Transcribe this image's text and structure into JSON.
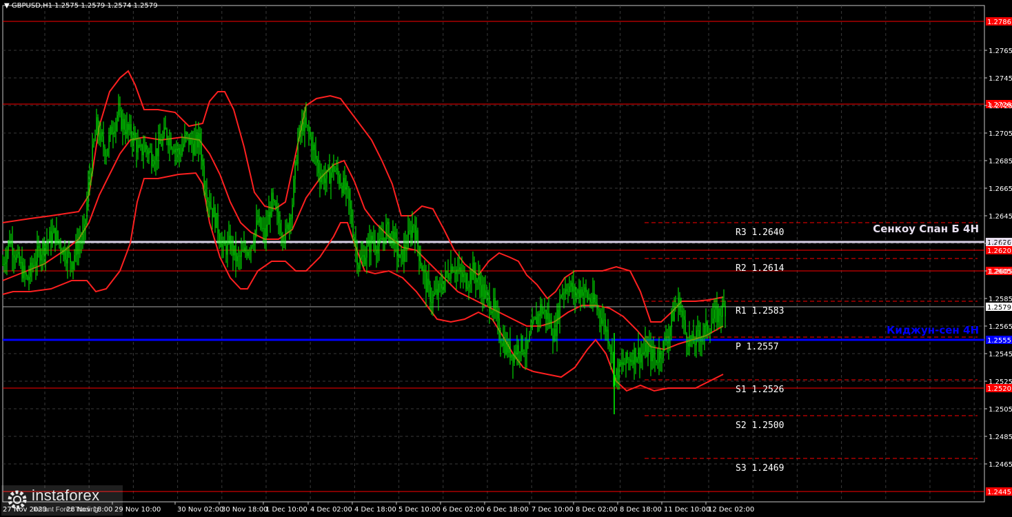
{
  "symbol_header": "GBPUSD,H1  1.2575 1.2579 1.2574 1.2579",
  "colors": {
    "background": "#000000",
    "grid": "#3a3a3a",
    "candle": "#00ff00",
    "level": "#ff0000",
    "bollinger": "#ff2020",
    "kijun": "#0000ff",
    "senkou": "#ffffff",
    "axis_text": "#ffffff"
  },
  "watermark": {
    "name": "instaforex",
    "tagline": "Instant Forex Trading"
  },
  "chart_data": {
    "type": "candlestick",
    "title": "GBPUSD,H1  1.2575 1.2579 1.2574 1.2579",
    "ylim": [
      1.2445,
      1.2787
    ],
    "grid": true,
    "y_ticks": [
      "1.2765",
      "1.2745",
      "1.2725",
      "1.2705",
      "1.2685",
      "1.2665",
      "1.2645",
      "1.2625",
      "1.2605",
      "1.2585",
      "1.2565",
      "1.2545",
      "1.2525",
      "1.2505",
      "1.2485",
      "1.2465"
    ],
    "x_ticks": [
      "29 Nov 10:00",
      "30 Nov 02:00",
      "30 Nov 18:00",
      "1 Dec 10:00",
      "4 Dec 02:00",
      "4 Dec 18:00",
      "5 Dec 10:00",
      "6 Dec 02:00",
      "6 Dec 18:00",
      "7 Dec 10:00",
      "8 Dec 02:00",
      "8 Dec 18:00",
      "11 Dec 10:00",
      "12 Dec 02:00"
    ],
    "x_ticks_partial": [
      "27 Nov 2023",
      "28 Nov 18:00"
    ],
    "levels": [
      {
        "value": 1.2786,
        "label": "1.2786"
      },
      {
        "value": 1.2726,
        "label": "1.2726"
      },
      {
        "value": 1.262,
        "label": "1.2620"
      },
      {
        "value": 1.2605,
        "label": "1.2605"
      },
      {
        "value": 1.252,
        "label": "1.2520"
      },
      {
        "value": 1.2445,
        "label": "1.2445"
      }
    ],
    "senkou_span_b": {
      "value": 1.2626,
      "label": "1.2626",
      "name": "Сенкоу Спан Б 4Н"
    },
    "kijun_sen": {
      "value": 1.2555,
      "label": "1.2555",
      "name": "Киджун-сен 4Н"
    },
    "current_price": {
      "value": 1.2579,
      "label": "1.2579"
    },
    "pivots": [
      {
        "name": "R3",
        "text": "R3 1.2640",
        "value": 1.264
      },
      {
        "name": "R2",
        "text": "R2 1.2614",
        "value": 1.2614
      },
      {
        "name": "R1",
        "text": "R1 1.2583",
        "value": 1.2583
      },
      {
        "name": "P",
        "text": "P 1.2557",
        "value": 1.2557
      },
      {
        "name": "S1",
        "text": "S1 1.2526",
        "value": 1.2526
      },
      {
        "name": "S2",
        "text": "S2 1.2500",
        "value": 1.25
      },
      {
        "name": "S3",
        "text": "S3 1.2469",
        "value": 1.2469
      }
    ],
    "price_path": [
      [
        0,
        1.261
      ],
      [
        10,
        1.2628
      ],
      [
        22,
        1.2612
      ],
      [
        35,
        1.2598
      ],
      [
        48,
        1.2615
      ],
      [
        62,
        1.2625
      ],
      [
        75,
        1.2632
      ],
      [
        88,
        1.262
      ],
      [
        100,
        1.2612
      ],
      [
        110,
        1.2625
      ],
      [
        118,
        1.2632
      ],
      [
        124,
        1.2665
      ],
      [
        130,
        1.269
      ],
      [
        136,
        1.271
      ],
      [
        142,
        1.27
      ],
      [
        150,
        1.2692
      ],
      [
        158,
        1.2708
      ],
      [
        166,
        1.2718
      ],
      [
        174,
        1.2712
      ],
      [
        182,
        1.2706
      ],
      [
        190,
        1.2702
      ],
      [
        198,
        1.269
      ],
      [
        206,
        1.2695
      ],
      [
        216,
        1.2688
      ],
      [
        226,
        1.2694
      ],
      [
        236,
        1.2705
      ],
      [
        246,
        1.2698
      ],
      [
        256,
        1.269
      ],
      [
        266,
        1.2702
      ],
      [
        276,
        1.2696
      ],
      [
        286,
        1.27
      ],
      [
        292,
        1.267
      ],
      [
        300,
        1.2655
      ],
      [
        310,
        1.264
      ],
      [
        320,
        1.262
      ],
      [
        330,
        1.2625
      ],
      [
        340,
        1.2612
      ],
      [
        350,
        1.2618
      ],
      [
        360,
        1.2625
      ],
      [
        370,
        1.264
      ],
      [
        380,
        1.263
      ],
      [
        390,
        1.2655
      ],
      [
        400,
        1.264
      ],
      [
        410,
        1.263
      ],
      [
        420,
        1.2655
      ],
      [
        428,
        1.27
      ],
      [
        436,
        1.2712
      ],
      [
        444,
        1.2705
      ],
      [
        452,
        1.269
      ],
      [
        460,
        1.2675
      ],
      [
        470,
        1.2672
      ],
      [
        480,
        1.268
      ],
      [
        490,
        1.267
      ],
      [
        500,
        1.266
      ],
      [
        508,
        1.2635
      ],
      [
        516,
        1.261
      ],
      [
        526,
        1.2618
      ],
      [
        536,
        1.2628
      ],
      [
        546,
        1.2622
      ],
      [
        556,
        1.2635
      ],
      [
        566,
        1.263
      ],
      [
        576,
        1.2612
      ],
      [
        586,
        1.2625
      ],
      [
        596,
        1.264
      ],
      [
        606,
        1.2612
      ],
      [
        614,
        1.2595
      ],
      [
        622,
        1.2585
      ],
      [
        632,
        1.259
      ],
      [
        642,
        1.26
      ],
      [
        652,
        1.261
      ],
      [
        662,
        1.2603
      ],
      [
        672,
        1.2598
      ],
      [
        682,
        1.2605
      ],
      [
        692,
        1.2595
      ],
      [
        702,
        1.2585
      ],
      [
        712,
        1.2578
      ],
      [
        720,
        1.256
      ],
      [
        730,
        1.255
      ],
      [
        740,
        1.2545
      ],
      [
        750,
        1.2552
      ],
      [
        760,
        1.2548
      ],
      [
        770,
        1.2565
      ],
      [
        780,
        1.2578
      ],
      [
        790,
        1.2572
      ],
      [
        800,
        1.2558
      ],
      [
        810,
        1.259
      ],
      [
        820,
        1.2595
      ],
      [
        830,
        1.2588
      ],
      [
        840,
        1.2592
      ],
      [
        850,
        1.2585
      ],
      [
        860,
        1.258
      ],
      [
        870,
        1.257
      ],
      [
        880,
        1.2555
      ],
      [
        888,
        1.2528
      ],
      [
        896,
        1.2535
      ],
      [
        906,
        1.254
      ],
      [
        916,
        1.2545
      ],
      [
        926,
        1.2545
      ],
      [
        936,
        1.2548
      ],
      [
        946,
        1.254
      ],
      [
        956,
        1.2548
      ],
      [
        966,
        1.256
      ],
      [
        974,
        1.2578
      ],
      [
        982,
        1.2582
      ],
      [
        990,
        1.256
      ],
      [
        1000,
        1.2552
      ],
      [
        1010,
        1.2558
      ],
      [
        1020,
        1.2562
      ],
      [
        1030,
        1.257
      ],
      [
        1040,
        1.2575
      ],
      [
        1048,
        1.2579
      ]
    ],
    "bollinger_upper": [
      [
        0,
        1.264
      ],
      [
        40,
        1.2643
      ],
      [
        70,
        1.2645
      ],
      [
        110,
        1.2648
      ],
      [
        125,
        1.266
      ],
      [
        140,
        1.271
      ],
      [
        155,
        1.2735
      ],
      [
        170,
        1.2745
      ],
      [
        182,
        1.275
      ],
      [
        192,
        1.274
      ],
      [
        205,
        1.2722
      ],
      [
        225,
        1.2722
      ],
      [
        250,
        1.272
      ],
      [
        270,
        1.271
      ],
      [
        290,
        1.2712
      ],
      [
        300,
        1.2728
      ],
      [
        312,
        1.2735
      ],
      [
        322,
        1.2735
      ],
      [
        335,
        1.2722
      ],
      [
        350,
        1.2695
      ],
      [
        365,
        1.2662
      ],
      [
        380,
        1.2652
      ],
      [
        395,
        1.265
      ],
      [
        410,
        1.2655
      ],
      [
        425,
        1.269
      ],
      [
        440,
        1.2725
      ],
      [
        455,
        1.273
      ],
      [
        475,
        1.2732
      ],
      [
        490,
        1.273
      ],
      [
        505,
        1.272
      ],
      [
        520,
        1.271
      ],
      [
        535,
        1.27
      ],
      [
        550,
        1.2685
      ],
      [
        565,
        1.2668
      ],
      [
        578,
        1.2645
      ],
      [
        592,
        1.2645
      ],
      [
        608,
        1.2652
      ],
      [
        624,
        1.265
      ],
      [
        640,
        1.2635
      ],
      [
        655,
        1.262
      ],
      [
        670,
        1.261
      ],
      [
        690,
        1.2602
      ],
      [
        705,
        1.2612
      ],
      [
        720,
        1.2618
      ],
      [
        735,
        1.2615
      ],
      [
        748,
        1.2612
      ],
      [
        760,
        1.2602
      ],
      [
        775,
        1.2595
      ],
      [
        790,
        1.2585
      ],
      [
        802,
        1.259
      ],
      [
        815,
        1.26
      ],
      [
        830,
        1.2605
      ],
      [
        850,
        1.2605
      ],
      [
        870,
        1.2605
      ],
      [
        890,
        1.2608
      ],
      [
        910,
        1.2605
      ],
      [
        925,
        1.259
      ],
      [
        940,
        1.2568
      ],
      [
        955,
        1.2568
      ],
      [
        970,
        1.2575
      ],
      [
        985,
        1.2583
      ],
      [
        1005,
        1.2583
      ],
      [
        1025,
        1.2584
      ],
      [
        1045,
        1.2586
      ]
    ],
    "bollinger_middle": [
      [
        0,
        1.2598
      ],
      [
        30,
        1.2604
      ],
      [
        60,
        1.261
      ],
      [
        90,
        1.262
      ],
      [
        110,
        1.2628
      ],
      [
        125,
        1.264
      ],
      [
        140,
        1.266
      ],
      [
        155,
        1.2675
      ],
      [
        170,
        1.269
      ],
      [
        185,
        1.27
      ],
      [
        205,
        1.2702
      ],
      [
        230,
        1.27
      ],
      [
        260,
        1.2702
      ],
      [
        285,
        1.27
      ],
      [
        300,
        1.269
      ],
      [
        315,
        1.2675
      ],
      [
        330,
        1.2655
      ],
      [
        345,
        1.264
      ],
      [
        360,
        1.2633
      ],
      [
        380,
        1.2628
      ],
      [
        400,
        1.2628
      ],
      [
        420,
        1.2635
      ],
      [
        440,
        1.2658
      ],
      [
        460,
        1.2672
      ],
      [
        480,
        1.2682
      ],
      [
        495,
        1.2685
      ],
      [
        510,
        1.267
      ],
      [
        525,
        1.265
      ],
      [
        540,
        1.264
      ],
      [
        560,
        1.263
      ],
      [
        580,
        1.2622
      ],
      [
        600,
        1.262
      ],
      [
        620,
        1.261
      ],
      [
        640,
        1.26
      ],
      [
        660,
        1.259
      ],
      [
        680,
        1.2585
      ],
      [
        700,
        1.258
      ],
      [
        720,
        1.2575
      ],
      [
        740,
        1.257
      ],
      [
        760,
        1.2565
      ],
      [
        780,
        1.2565
      ],
      [
        800,
        1.2568
      ],
      [
        820,
        1.2575
      ],
      [
        840,
        1.258
      ],
      [
        860,
        1.258
      ],
      [
        880,
        1.2578
      ],
      [
        900,
        1.2572
      ],
      [
        920,
        1.2562
      ],
      [
        940,
        1.255
      ],
      [
        960,
        1.2548
      ],
      [
        980,
        1.2552
      ],
      [
        1000,
        1.2555
      ],
      [
        1020,
        1.2558
      ],
      [
        1045,
        1.2565
      ]
    ],
    "bollinger_lower": [
      [
        0,
        1.2588
      ],
      [
        15,
        1.259
      ],
      [
        40,
        1.259
      ],
      [
        70,
        1.2592
      ],
      [
        100,
        1.2598
      ],
      [
        122,
        1.2598
      ],
      [
        135,
        1.259
      ],
      [
        150,
        1.2592
      ],
      [
        170,
        1.2605
      ],
      [
        185,
        1.2625
      ],
      [
        195,
        1.2655
      ],
      [
        205,
        1.2672
      ],
      [
        225,
        1.2672
      ],
      [
        255,
        1.2675
      ],
      [
        280,
        1.2676
      ],
      [
        290,
        1.2668
      ],
      [
        300,
        1.264
      ],
      [
        315,
        1.2615
      ],
      [
        330,
        1.26
      ],
      [
        345,
        1.2592
      ],
      [
        355,
        1.2592
      ],
      [
        370,
        1.2605
      ],
      [
        390,
        1.2612
      ],
      [
        410,
        1.2612
      ],
      [
        425,
        1.2605
      ],
      [
        440,
        1.2605
      ],
      [
        460,
        1.2615
      ],
      [
        480,
        1.263
      ],
      [
        490,
        1.264
      ],
      [
        500,
        1.264
      ],
      [
        510,
        1.2625
      ],
      [
        525,
        1.2605
      ],
      [
        540,
        1.2603
      ],
      [
        560,
        1.2605
      ],
      [
        580,
        1.26
      ],
      [
        600,
        1.259
      ],
      [
        615,
        1.258
      ],
      [
        630,
        1.257
      ],
      [
        650,
        1.2568
      ],
      [
        670,
        1.257
      ],
      [
        690,
        1.2575
      ],
      [
        710,
        1.257
      ],
      [
        725,
        1.2558
      ],
      [
        740,
        1.2545
      ],
      [
        755,
        1.2535
      ],
      [
        770,
        1.2532
      ],
      [
        790,
        1.253
      ],
      [
        810,
        1.2528
      ],
      [
        830,
        1.2535
      ],
      [
        848,
        1.2548
      ],
      [
        860,
        1.2555
      ],
      [
        875,
        1.2545
      ],
      [
        890,
        1.2525
      ],
      [
        905,
        1.2518
      ],
      [
        925,
        1.2522
      ],
      [
        945,
        1.2518
      ],
      [
        965,
        1.252
      ],
      [
        985,
        1.252
      ],
      [
        1005,
        1.252
      ],
      [
        1025,
        1.2525
      ],
      [
        1045,
        1.253
      ]
    ]
  }
}
